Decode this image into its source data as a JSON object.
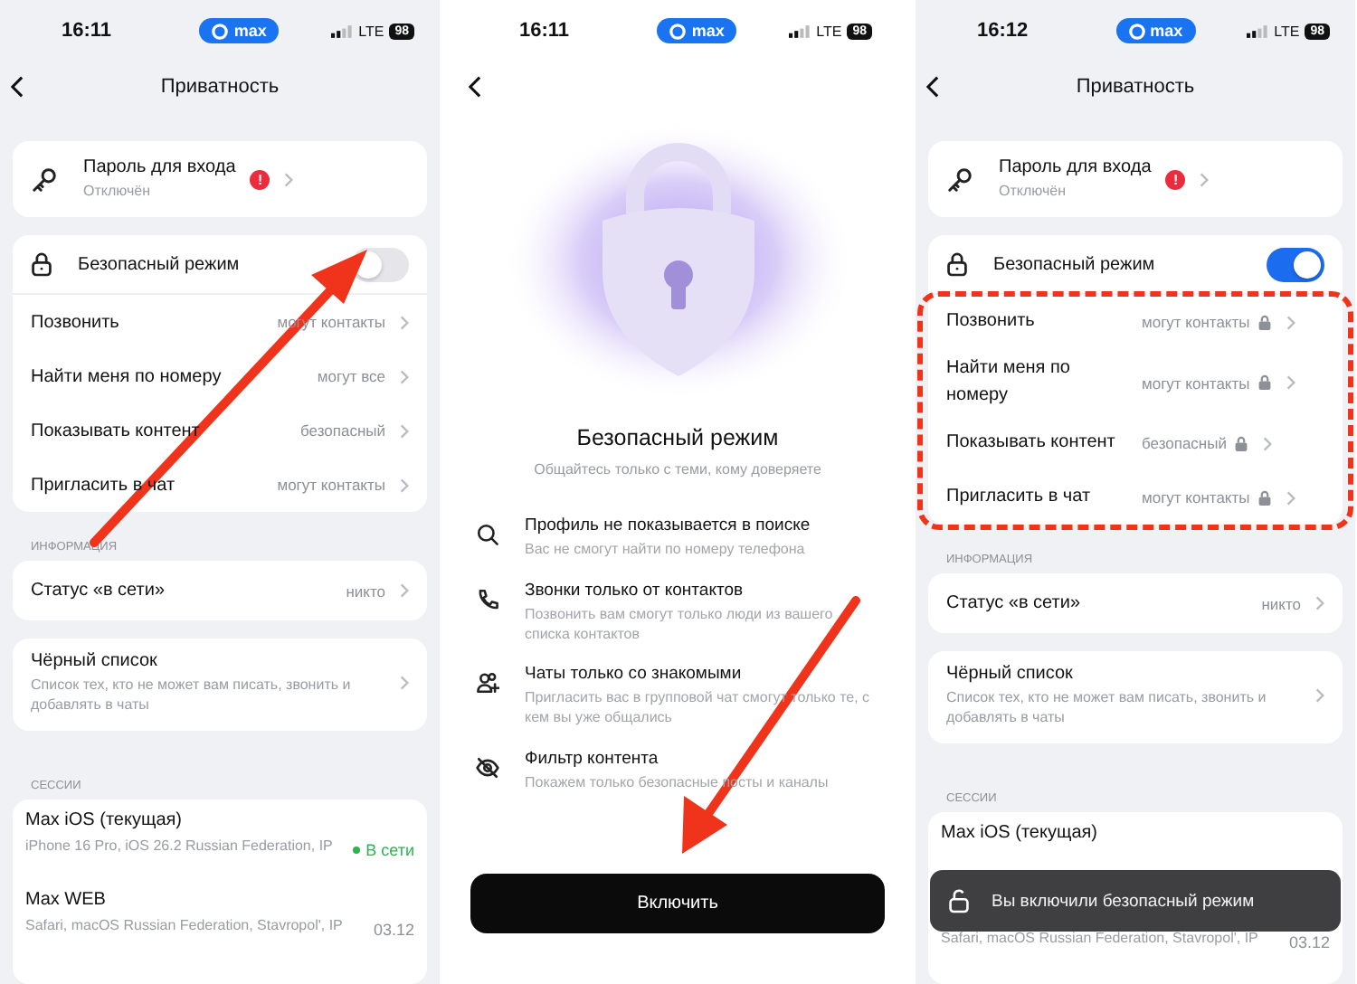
{
  "screens": [
    {
      "kind": "settings",
      "status_bar": {
        "time": "16:11",
        "app": "max",
        "network": "LTE",
        "battery": "98"
      },
      "title": "Приватность",
      "password": {
        "title": "Пароль для входа",
        "subtitle": "Отключён",
        "alert": "!"
      },
      "safe_mode": {
        "label": "Безопасный режим",
        "on": false
      },
      "privacy_rows": [
        {
          "label": "Позвонить",
          "value": "могут контакты",
          "locked": false
        },
        {
          "label": "Найти меня по номеру",
          "value": "могут все",
          "locked": false
        },
        {
          "label": "Показывать контент",
          "value": "безопасный",
          "locked": false
        },
        {
          "label": "Пригласить в чат",
          "value": "могут контакты",
          "locked": false
        }
      ],
      "info_header": "ИНФОРМАЦИЯ",
      "online_status": {
        "label": "Статус «в сети»",
        "value": "никто"
      },
      "blacklist": {
        "title": "Чёрный список",
        "description": "Список тех, кто не может вам писать, звонить и добавлять в чаты"
      },
      "sessions_header": "СЕССИИ",
      "sessions": [
        {
          "name": "Max iOS (текущая)",
          "details": "iPhone 16 Pro, iOS 26.2 Russian Federation, IP",
          "status": "В сети",
          "online": true
        },
        {
          "name": "Max WEB",
          "details": "Safari, macOS Russian Federation, Stavropol', IP",
          "status": "03.12",
          "online": false
        }
      ]
    },
    {
      "kind": "intro",
      "status_bar": {
        "time": "16:11",
        "app": "max",
        "network": "LTE",
        "battery": "98"
      },
      "title": "Безопасный режим",
      "subtitle": "Общайтесь только с теми, кому доверяете",
      "features": [
        {
          "kind": "search",
          "title": "Профиль не показывается в поиске",
          "text": "Вас не смогут найти по номеру телефона"
        },
        {
          "kind": "phone",
          "title": "Звонки только от контактов",
          "text": "Позвонить вам смогут только люди из вашего списка контактов"
        },
        {
          "kind": "people",
          "title": "Чаты только со знакомыми",
          "text": "Пригласить вас в групповой чат смогут только те, с кем вы уже общались"
        },
        {
          "kind": "eye-off",
          "title": "Фильтр контента",
          "text": "Покажем только безопасные посты и каналы"
        }
      ],
      "button": "Включить"
    },
    {
      "kind": "settings",
      "status_bar": {
        "time": "16:12",
        "app": "max",
        "network": "LTE",
        "battery": "98"
      },
      "title": "Приватность",
      "password": {
        "title": "Пароль для входа",
        "subtitle": "Отключён",
        "alert": "!"
      },
      "safe_mode": {
        "label": "Безопасный режим",
        "on": true
      },
      "rows_highlighted": true,
      "privacy_rows": [
        {
          "label": "Позвонить",
          "value": "могут контакты",
          "locked": true
        },
        {
          "label": "Найти меня по номеру",
          "value": "могут контакты",
          "locked": true
        },
        {
          "label": "Показывать контент",
          "value": "безопасный",
          "locked": true
        },
        {
          "label": "Пригласить в чат",
          "value": "могут контакты",
          "locked": true
        }
      ],
      "info_header": "ИНФОРМАЦИЯ",
      "online_status": {
        "label": "Статус «в сети»",
        "value": "никто"
      },
      "blacklist": {
        "title": "Чёрный список",
        "description": "Список тех, кто не может вам писать, звонить и добавлять в чаты"
      },
      "sessions_header": "СЕССИИ",
      "sessions": [
        {
          "name": "Max iOS (текущая)"
        },
        {
          "details": "Safari, macOS Russian Federation, Stavropol', IP",
          "status": "03.12"
        }
      ],
      "toast": "Вы включили безопасный режим"
    }
  ]
}
